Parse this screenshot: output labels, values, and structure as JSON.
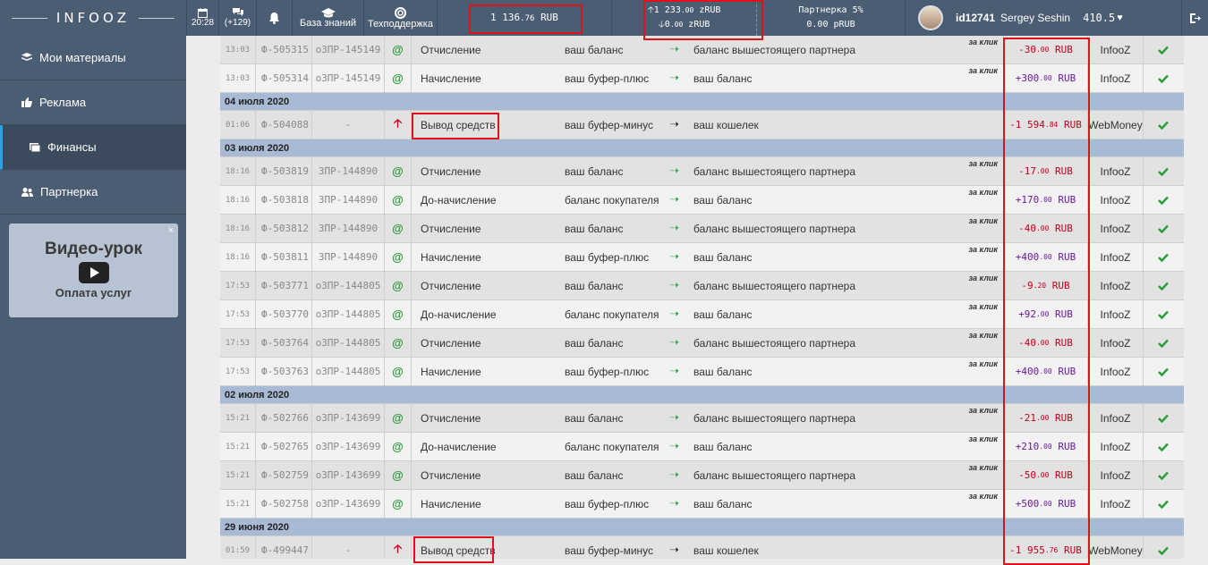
{
  "topbar": {
    "logo": "INFOOZ",
    "time": "20:28",
    "messages_badge": "(+129)",
    "knowledge_base": "База знаний",
    "support": "Техподдержка",
    "balance": "1 136",
    "balance_fraction": ".76",
    "balance_currency": "RUB",
    "z_in": "1 233",
    "z_in_fraction": ".00",
    "z_in_currency": "zRUB",
    "z_out": "0",
    "z_out_fraction": ".00",
    "z_out_currency": "zRUB",
    "partner_label": "Партнерка 5%",
    "partner_value": "0.00",
    "partner_currency": "pRUB",
    "user_id": "id12741",
    "user_name": "Sergey Seshin",
    "user_rating": "410.5"
  },
  "sidebar": {
    "items": [
      {
        "label": "Мои материалы"
      },
      {
        "label": "Реклама"
      },
      {
        "label": "Финансы"
      },
      {
        "label": "Партнерка"
      }
    ],
    "video_title": "Видео-урок",
    "video_subtitle": "Оплата услуг",
    "video_close": "×"
  },
  "rows": [
    {
      "type": "tx",
      "time": "13:03",
      "fid": "Ф-505315",
      "zid": "оЗПР-145149",
      "icon": "@",
      "op": "Отчисление",
      "from": "ваш баланс",
      "to": "баланс вышестоящего партнера",
      "per_click": "за клик",
      "amount": "-30",
      "amount_frac": ".00",
      "cur": "RUB",
      "sign": "neg",
      "system": "InfooZ"
    },
    {
      "type": "tx",
      "time": "13:03",
      "fid": "Ф-505314",
      "zid": "оЗПР-145149",
      "icon": "@",
      "op": "Начисление",
      "from": "ваш буфер-плюс",
      "to": "ваш баланс",
      "per_click": "за клик",
      "amount": "+300",
      "amount_frac": ".00",
      "cur": "RUB",
      "sign": "pos",
      "system": "InfooZ"
    },
    {
      "type": "date",
      "label": "04 июля 2020"
    },
    {
      "type": "tx",
      "time": "01:06",
      "fid": "Ф-504088",
      "zid": "-",
      "icon": "up",
      "op": "Вывод средств",
      "from": "ваш буфер-минус",
      "to": "ваш кошелек",
      "per_click": "",
      "amount": "-1 594",
      "amount_frac": ".84",
      "cur": "RUB",
      "sign": "neg",
      "system": "WebMoney"
    },
    {
      "type": "date",
      "label": "03 июля 2020"
    },
    {
      "type": "tx",
      "time": "18:16",
      "fid": "Ф-503819",
      "zid": "ЗПР-144890",
      "icon": "@",
      "op": "Отчисление",
      "from": "ваш баланс",
      "to": "баланс вышестоящего партнера",
      "per_click": "за клик",
      "amount": "-17",
      "amount_frac": ".00",
      "cur": "RUB",
      "sign": "neg",
      "system": "InfooZ"
    },
    {
      "type": "tx",
      "time": "18:16",
      "fid": "Ф-503818",
      "zid": "ЗПР-144890",
      "icon": "@",
      "op": "До-начисление",
      "from": "баланс покупателя",
      "to": "ваш баланс",
      "per_click": "за клик",
      "amount": "+170",
      "amount_frac": ".00",
      "cur": "RUB",
      "sign": "pos",
      "system": "InfooZ"
    },
    {
      "type": "tx",
      "time": "18:16",
      "fid": "Ф-503812",
      "zid": "ЗПР-144890",
      "icon": "@",
      "op": "Отчисление",
      "from": "ваш баланс",
      "to": "баланс вышестоящего партнера",
      "per_click": "за клик",
      "amount": "-40",
      "amount_frac": ".00",
      "cur": "RUB",
      "sign": "neg",
      "system": "InfooZ"
    },
    {
      "type": "tx",
      "time": "18:16",
      "fid": "Ф-503811",
      "zid": "ЗПР-144890",
      "icon": "@",
      "op": "Начисление",
      "from": "ваш буфер-плюс",
      "to": "ваш баланс",
      "per_click": "за клик",
      "amount": "+400",
      "amount_frac": ".00",
      "cur": "RUB",
      "sign": "pos",
      "system": "InfooZ"
    },
    {
      "type": "tx",
      "time": "17:53",
      "fid": "Ф-503771",
      "zid": "оЗПР-144805",
      "icon": "@",
      "op": "Отчисление",
      "from": "ваш баланс",
      "to": "баланс вышестоящего партнера",
      "per_click": "за клик",
      "amount": "-9",
      "amount_frac": ".20",
      "cur": "RUB",
      "sign": "neg",
      "system": "InfooZ"
    },
    {
      "type": "tx",
      "time": "17:53",
      "fid": "Ф-503770",
      "zid": "оЗПР-144805",
      "icon": "@",
      "op": "До-начисление",
      "from": "баланс покупателя",
      "to": "ваш баланс",
      "per_click": "за клик",
      "amount": "+92",
      "amount_frac": ".00",
      "cur": "RUB",
      "sign": "pos",
      "system": "InfooZ"
    },
    {
      "type": "tx",
      "time": "17:53",
      "fid": "Ф-503764",
      "zid": "оЗПР-144805",
      "icon": "@",
      "op": "Отчисление",
      "from": "ваш баланс",
      "to": "баланс вышестоящего партнера",
      "per_click": "за клик",
      "amount": "-40",
      "amount_frac": ".00",
      "cur": "RUB",
      "sign": "neg",
      "system": "InfooZ"
    },
    {
      "type": "tx",
      "time": "17:53",
      "fid": "Ф-503763",
      "zid": "оЗПР-144805",
      "icon": "@",
      "op": "Начисление",
      "from": "ваш буфер-плюс",
      "to": "ваш баланс",
      "per_click": "за клик",
      "amount": "+400",
      "amount_frac": ".00",
      "cur": "RUB",
      "sign": "pos",
      "system": "InfooZ"
    },
    {
      "type": "date",
      "label": "02 июля 2020"
    },
    {
      "type": "tx",
      "time": "15:21",
      "fid": "Ф-502766",
      "zid": "оЗПР-143699",
      "icon": "@",
      "op": "Отчисление",
      "from": "ваш баланс",
      "to": "баланс вышестоящего партнера",
      "per_click": "за клик",
      "amount": "-21",
      "amount_frac": ".00",
      "cur": "RUB",
      "sign": "neg",
      "system": "InfooZ"
    },
    {
      "type": "tx",
      "time": "15:21",
      "fid": "Ф-502765",
      "zid": "оЗПР-143699",
      "icon": "@",
      "op": "До-начисление",
      "from": "баланс покупателя",
      "to": "ваш баланс",
      "per_click": "за клик",
      "amount": "+210",
      "amount_frac": ".00",
      "cur": "RUB",
      "sign": "pos",
      "system": "InfooZ"
    },
    {
      "type": "tx",
      "time": "15:21",
      "fid": "Ф-502759",
      "zid": "оЗПР-143699",
      "icon": "@",
      "op": "Отчисление",
      "from": "ваш баланс",
      "to": "баланс вышестоящего партнера",
      "per_click": "за клик",
      "amount": "-50",
      "amount_frac": ".00",
      "cur": "RUB",
      "sign": "neg",
      "system": "InfooZ"
    },
    {
      "type": "tx",
      "time": "15:21",
      "fid": "Ф-502758",
      "zid": "оЗПР-143699",
      "icon": "@",
      "op": "Начисление",
      "from": "ваш буфер-плюс",
      "to": "ваш баланс",
      "per_click": "за клик",
      "amount": "+500",
      "amount_frac": ".00",
      "cur": "RUB",
      "sign": "pos",
      "system": "InfooZ"
    },
    {
      "type": "date",
      "label": "29 июня 2020"
    },
    {
      "type": "tx",
      "time": "01:59",
      "fid": "Ф-499447",
      "zid": "-",
      "icon": "up",
      "op": "Вывод средств",
      "from": "ваш буфер-минус",
      "to": "ваш кошелек",
      "per_click": "",
      "amount": "-1 955",
      "amount_frac": ".76",
      "cur": "RUB",
      "sign": "neg",
      "system": "WebMoney"
    }
  ],
  "colors": {
    "accent": "#29a3e0",
    "topbar": "#4b5d73",
    "negative": "#c0001c",
    "positive": "#6a1a9a",
    "highlight": "#e0111b"
  }
}
